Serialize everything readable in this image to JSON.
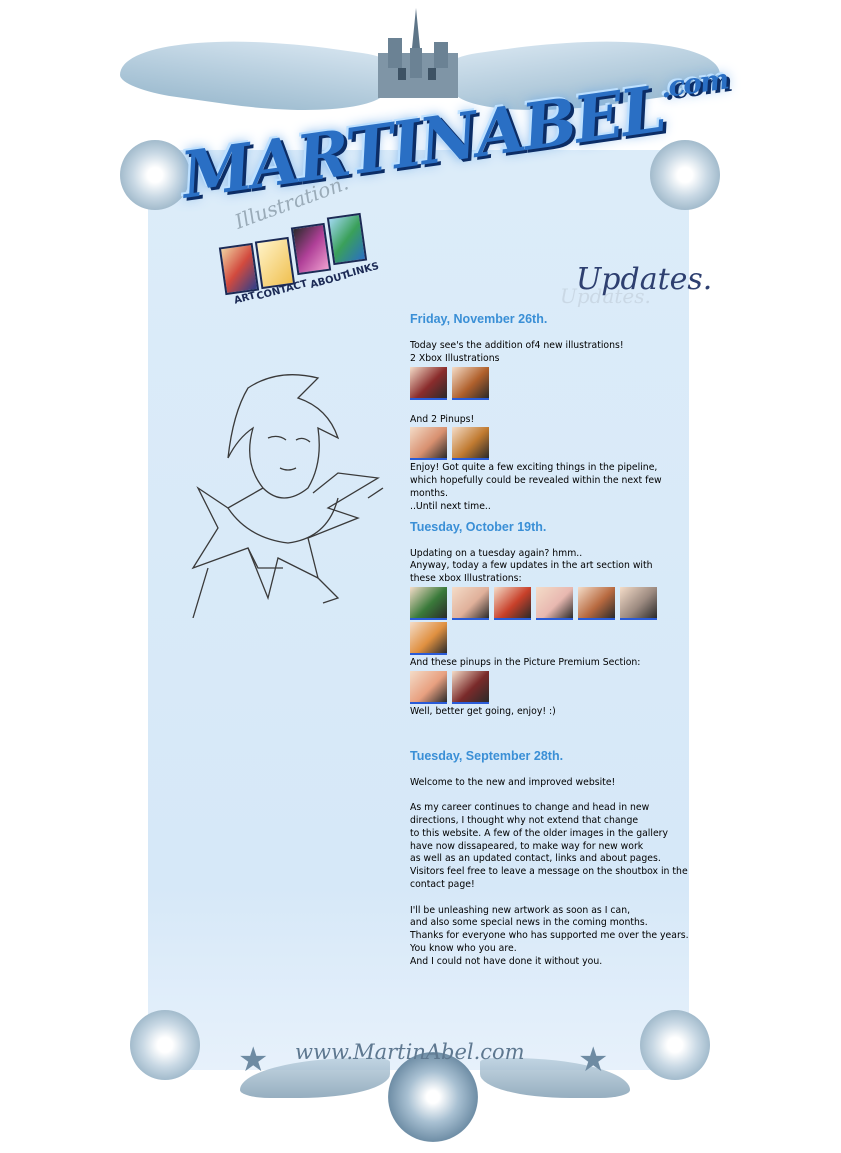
{
  "header": {
    "logo_main": "MARTINABEL",
    "logo_suffix": ".com",
    "tagline": "Illustration.",
    "nav": [
      {
        "label": "ART",
        "icon": "art-icon",
        "color": "#d24a3e"
      },
      {
        "label": "CONTACT",
        "icon": "envelope-icon",
        "color": "#f0c050"
      },
      {
        "label": "ABOUT",
        "icon": "about-icon",
        "color": "#b04098"
      },
      {
        "label": "LINKS",
        "icon": "globe-icon",
        "color": "#3aa05a"
      }
    ],
    "section_title": "Updates.",
    "section_shadow": "Updates."
  },
  "entries": [
    {
      "date": "Friday, November 26th.",
      "blocks": [
        {
          "text": "Today see's the addition of4 new illustrations!\n2 Xbox Illustrations"
        },
        {
          "thumbs": [
            "#8a2c2c",
            "#b0602c"
          ]
        },
        {
          "spacer": true
        },
        {
          "text": "And 2 Pinups!"
        },
        {
          "thumbs": [
            "#d89070",
            "#c07a30"
          ]
        },
        {
          "text": "Enjoy! Got quite a few exciting things in the pipeline,\nwhich hopefully could be revealed within the next few\nmonths.\n..Until next time.."
        }
      ]
    },
    {
      "date": "Tuesday, October 19th.",
      "blocks": [
        {
          "text": "Updating on a tuesday again? hmm..\nAnyway, today a few updates in the art section with\nthese xbox Illustrations:"
        },
        {
          "thumbs": [
            "#3a7a3a",
            "#e0b09a",
            "#c8402a",
            "#e8b8b0",
            "#b86a40",
            "#9c8a80",
            "#e09040"
          ]
        },
        {
          "text": "And these pinups in the Picture Premium Section:"
        },
        {
          "thumbs": [
            "#e8a080",
            "#7a2a2a"
          ]
        },
        {
          "text": "Well, better get going, enjoy! :)"
        },
        {
          "spacer": true
        },
        {
          "spacer": true
        }
      ]
    },
    {
      "date": "Tuesday, September 28th.",
      "blocks": [
        {
          "text": "Welcome to the new and improved website!\n\nAs my career continues to change and head in new\ndirections, I thought why not extend that change\nto this website. A few of the older images in the gallery\nhave now dissapeared, to make way for new work\nas well as an updated contact, links and about pages.\nVisitors feel free to leave a message on the shoutbox in the\ncontact page!\n\nI'll be unleashing new artwork as soon as I can,\nand also some special news in the coming months.\nThanks for everyone who has supported me over the years.\nYou know who you are.\nAnd I could not have done it without you."
        }
      ]
    }
  ],
  "footer": {
    "url": "www.MartinAbel.com"
  }
}
